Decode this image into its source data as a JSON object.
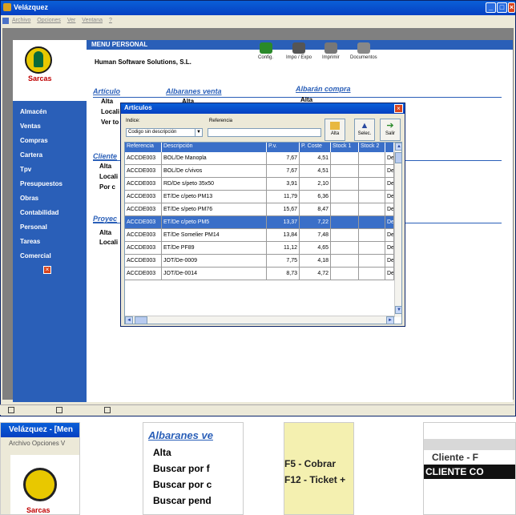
{
  "window": {
    "title": "Velázquez",
    "menu": [
      "Archivo",
      "Opciones",
      "Ver",
      "Ventana",
      "?"
    ]
  },
  "brand": {
    "name": "Sarcas"
  },
  "sidebar": {
    "items": [
      "Almacén",
      "Ventas",
      "Compras",
      "Cartera",
      "Tpv",
      "Presupuestos",
      "Obras",
      "Contabilidad",
      "Personal",
      "Tareas",
      "Comercial"
    ]
  },
  "main": {
    "title": "MENU PERSONAL",
    "company": "Human Software Solutions, S.L.",
    "toolbar": [
      "Config.",
      "Impo / Expo",
      "Imprimir",
      "Documentos"
    ],
    "sections": {
      "articulo": {
        "heading": "Artículo",
        "items": [
          "Alta",
          "Locali",
          "Ver to"
        ]
      },
      "albaranes_venta": {
        "heading": "Albaranes venta",
        "first": "Alta"
      },
      "albaran_compra": {
        "heading": "Albarán compra",
        "first": "Alta"
      },
      "cliente": {
        "heading": "Cliente",
        "items": [
          "Alta",
          "Locali",
          "Por c"
        ]
      },
      "proyecto": {
        "heading": "Proyec",
        "items": [
          "Alta",
          "Locali"
        ]
      }
    }
  },
  "dialog": {
    "title": "Artículos",
    "indice_label": "Indice:",
    "indice_value": "Codigo sin descripción",
    "referencia_label": "Referencia",
    "referencia_value": "",
    "buttons": [
      "Alta",
      "Selec.",
      "Salir"
    ],
    "columns": [
      "Referencia",
      "Descripción",
      "P.v.",
      "P. Coste",
      "Stock 1",
      "Stock 2",
      ""
    ],
    "selected_row": 5,
    "rows": [
      [
        "ACCDE003",
        "BOL/De Manopla",
        "7,67",
        "4,51",
        "",
        "",
        "Del"
      ],
      [
        "ACCDE003",
        "BOL/De c/vivos",
        "7,67",
        "4,51",
        "",
        "",
        "Del"
      ],
      [
        "ACCDE003",
        "RD/De s/peto 35x50",
        "3,91",
        "2,10",
        "",
        "",
        "Del"
      ],
      [
        "ACCDE003",
        "ET/De c/peto PM13",
        "11,79",
        "6,36",
        "",
        "",
        "Del"
      ],
      [
        "ACCDE003",
        "ET/De s/peto PM76",
        "15,67",
        "8,47",
        "",
        "",
        "Del"
      ],
      [
        "ACCDE003",
        "ET/De c/peto PM5",
        "13,37",
        "7,22",
        "",
        "",
        "Del"
      ],
      [
        "ACCDE003",
        "ET/De Somelier PM14",
        "13,84",
        "7,48",
        "",
        "",
        "Del"
      ],
      [
        "ACCDE003",
        "ET/De PF89",
        "11,12",
        "4,65",
        "",
        "",
        "Del"
      ],
      [
        "ACCDE003",
        "JOT/De-0009",
        "7,75",
        "4,18",
        "",
        "",
        "Del"
      ],
      [
        "ACCDE003",
        "JOT/De-0014",
        "8,73",
        "4,72",
        "",
        "",
        "Del"
      ]
    ]
  },
  "thumbnails": {
    "t1": {
      "title": "Velázquez - [Men",
      "menu": "Archivo  Opciones  V",
      "red": "Sarcas"
    },
    "t2": {
      "heading": "Albaranes ve",
      "items": [
        "Alta",
        "Buscar por f",
        "Buscar por c",
        "Buscar pend"
      ]
    },
    "t3": {
      "keys": [
        "F5 - Cobrar",
        "F12 - Ticket +"
      ]
    },
    "t4": {
      "line1": "Cliente - F",
      "line2": "CLIENTE CO"
    }
  },
  "colors": {
    "title_blue": "#0a5fd8",
    "sidebar_blue": "#2a5fb8",
    "selection": "#3a6fc8",
    "brand_red": "#c00000"
  }
}
